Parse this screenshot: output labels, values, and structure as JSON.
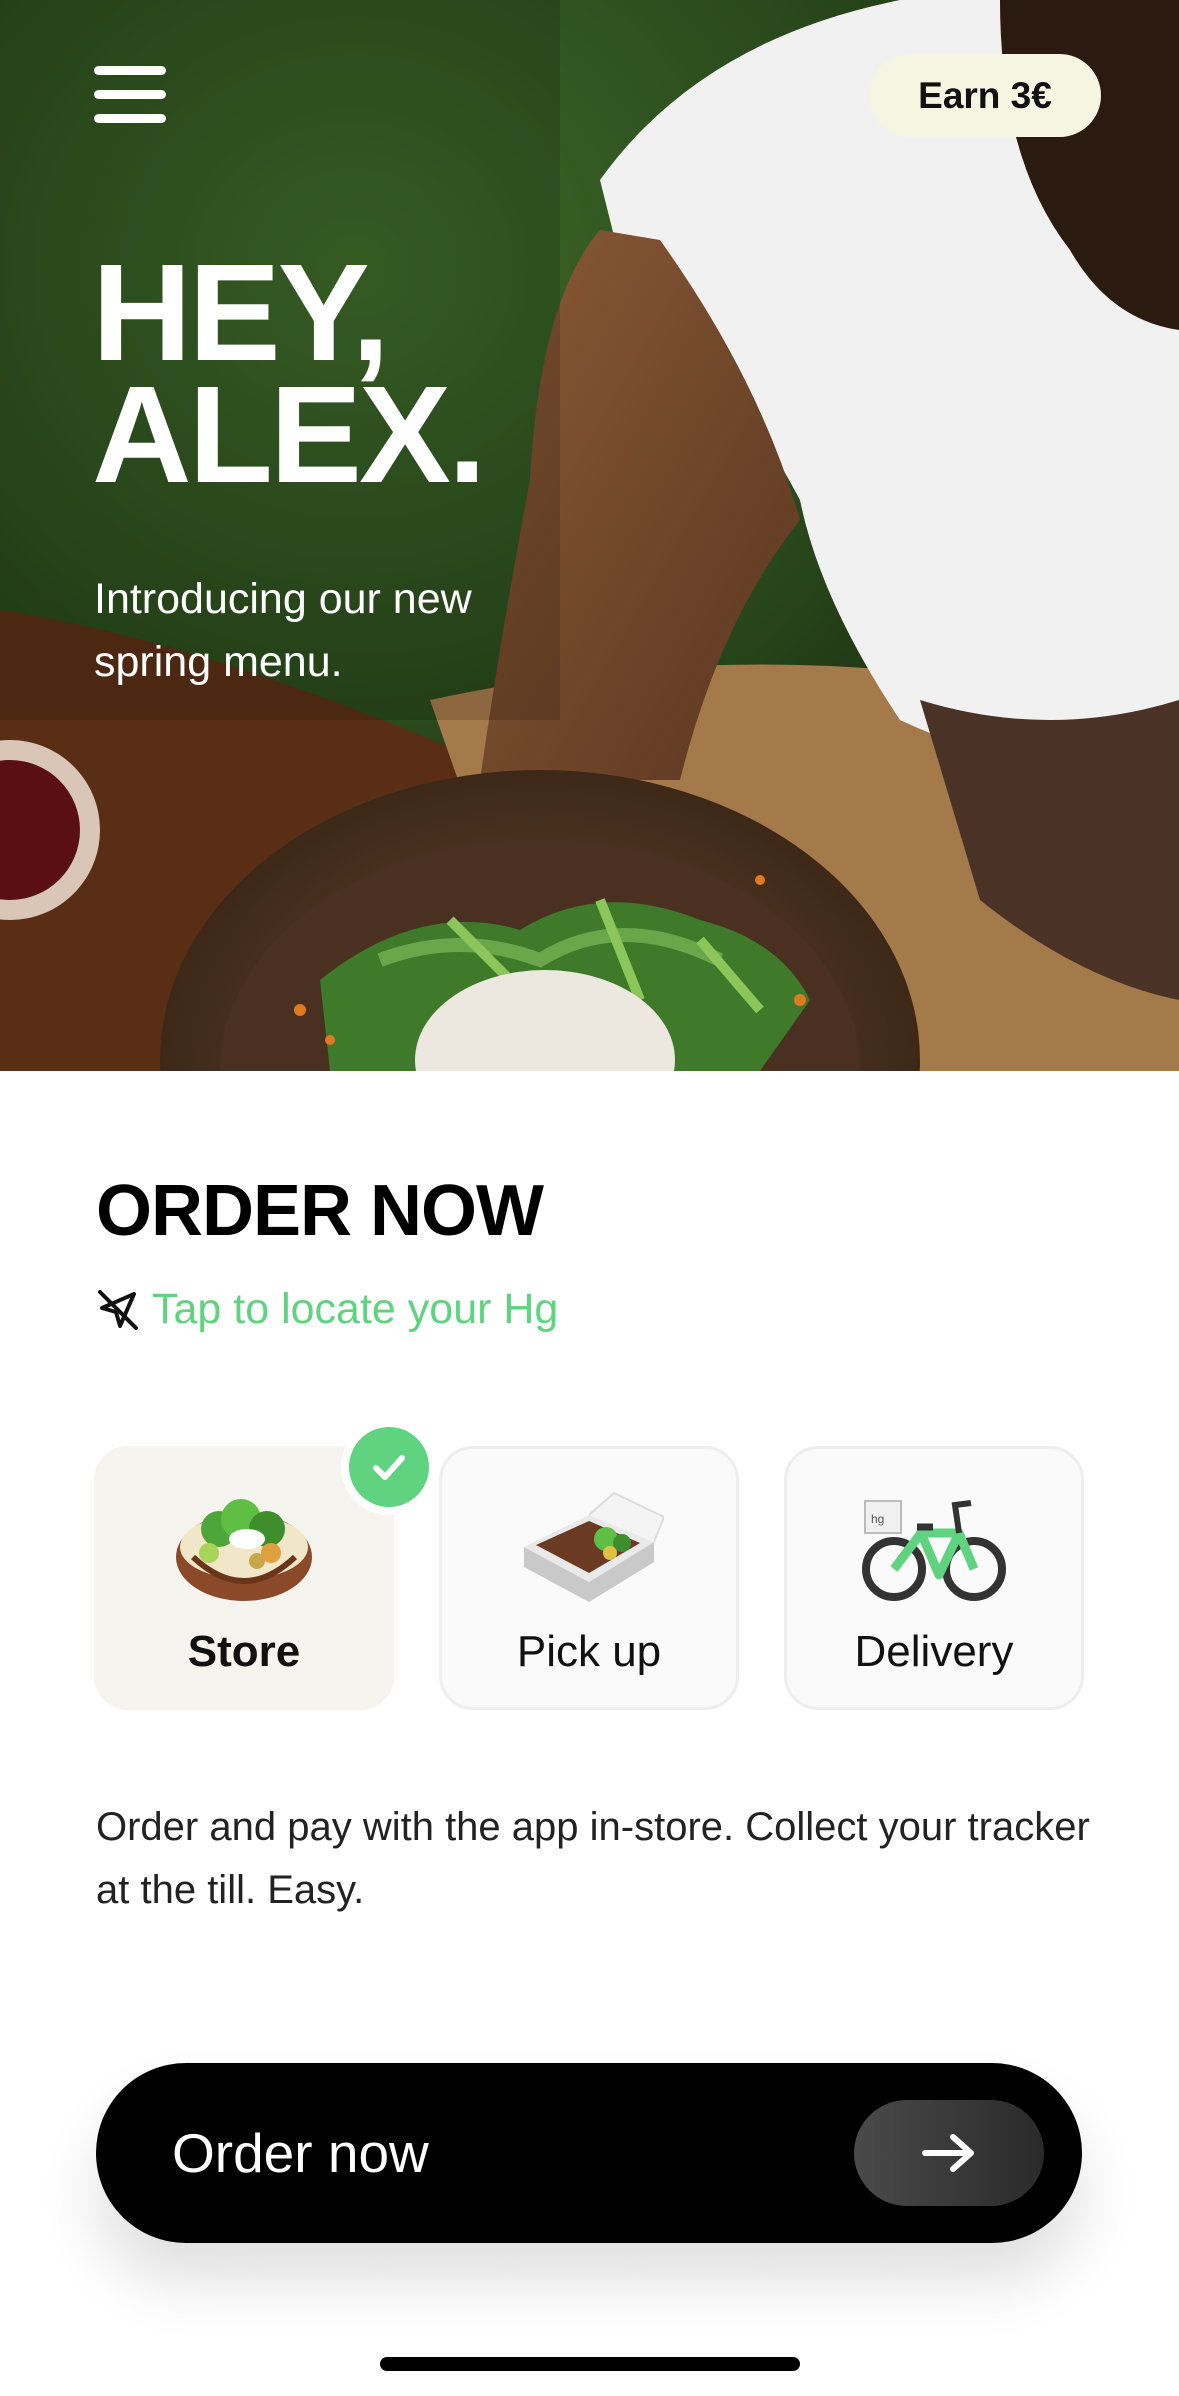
{
  "header": {
    "earn_label": "Earn 3€"
  },
  "hero": {
    "title_line1": "HEY,",
    "title_line2": "ALEX.",
    "subtitle": "Introducing our new spring menu."
  },
  "order": {
    "title": "ORDER NOW",
    "locate_label": "Tap to locate your Hg",
    "options": [
      {
        "label": "Store",
        "selected": true,
        "icon": "bowl-icon"
      },
      {
        "label": "Pick up",
        "selected": false,
        "icon": "takeaway-box-icon"
      },
      {
        "label": "Delivery",
        "selected": false,
        "icon": "bicycle-icon"
      }
    ],
    "description": "Order and pay with the app in-store. Collect your tracker at the till. Easy.",
    "cta_label": "Order now"
  },
  "colors": {
    "accent_green": "#5fd37f",
    "earn_pill": "#f5f5e1",
    "cta_bg": "#000000"
  }
}
